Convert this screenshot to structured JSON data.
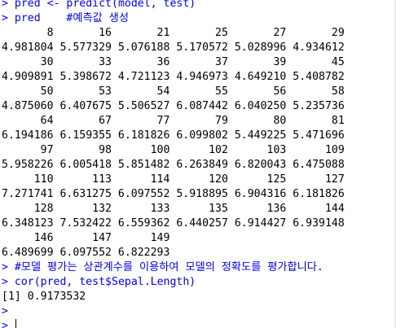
{
  "console": {
    "prompt": ">",
    "lines": [
      {
        "type": "cmd",
        "text": "pred <- predict(model, test)"
      },
      {
        "type": "cmd",
        "text": "pred    #예측값 생성"
      },
      {
        "type": "out",
        "text": "       8       16       21       25       27       29"
      },
      {
        "type": "out",
        "text": "4.981804 5.577329 5.076188 5.170572 5.028996 4.934612"
      },
      {
        "type": "out",
        "text": "      30       33       36       37       39       45"
      },
      {
        "type": "out",
        "text": "4.909891 5.398672 4.721123 4.946973 4.649210 5.408782"
      },
      {
        "type": "out",
        "text": "      50       53       54       55       56       58"
      },
      {
        "type": "out",
        "text": "4.875060 6.407675 5.506527 6.087442 6.040250 5.235736"
      },
      {
        "type": "out",
        "text": "      64       67       77       79       80       81"
      },
      {
        "type": "out",
        "text": "6.194186 6.159355 6.181826 6.099802 5.449225 5.471696"
      },
      {
        "type": "out",
        "text": "      97       98      100      102      103      109"
      },
      {
        "type": "out",
        "text": "5.958226 6.005418 5.851482 6.263849 6.820043 6.475088"
      },
      {
        "type": "out",
        "text": "     110      113      114      120      125      127"
      },
      {
        "type": "out",
        "text": "7.271741 6.631275 6.097552 5.918895 6.904316 6.181826"
      },
      {
        "type": "out",
        "text": "     128      132      133      135      136      144"
      },
      {
        "type": "out",
        "text": "6.348123 7.532422 6.559362 6.440257 6.914427 6.939148"
      },
      {
        "type": "out",
        "text": "     146      147      149"
      },
      {
        "type": "out",
        "text": "6.489699 6.097552 6.822293"
      },
      {
        "type": "cmd",
        "text": "#모델 평가는 상관계수를 이용하여 모델의 정확도를 평가합니다."
      },
      {
        "type": "cmd",
        "text": "cor(pred, test$Sepal.Length)"
      },
      {
        "type": "out",
        "text": "[1] 0.9173532"
      },
      {
        "type": "cmd",
        "text": ""
      },
      {
        "type": "active",
        "text": ""
      }
    ]
  },
  "colors": {
    "command": "#0000ff",
    "output": "#000000",
    "background": "#ffffff"
  }
}
